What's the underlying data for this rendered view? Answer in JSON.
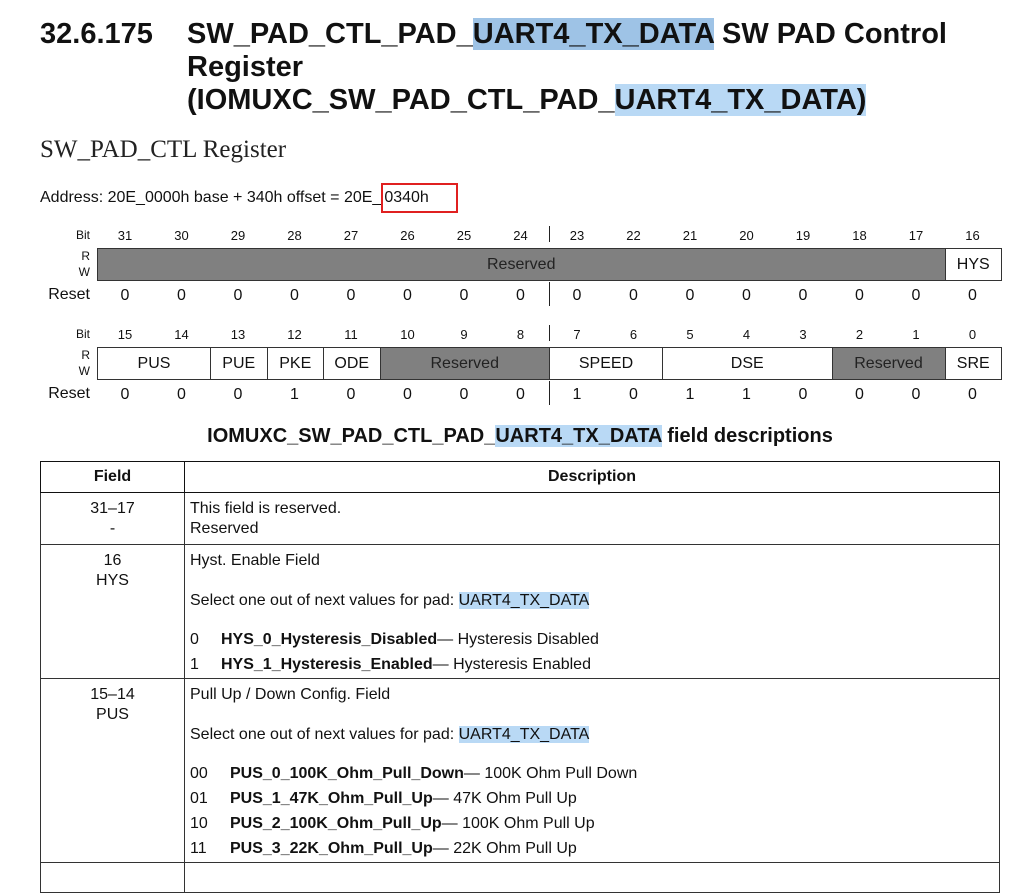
{
  "section": {
    "number": "32.6.175",
    "title_line1_pre": "SW_PAD_CTL_PAD_",
    "title_line1_hl": "UART4_TX_DATA",
    "title_line1_post": " SW PAD Control",
    "title_line2": "Register",
    "title_line3_pre": "(IOMUXC_SW_PAD_CTL_PAD_",
    "title_line3_hl": "UART4_TX_DATA)"
  },
  "subtitle": "SW_PAD_CTL Register",
  "address": {
    "prefix": "Address: 20E_0000h base + 340h offset = 20E_",
    "boxed": "0340h"
  },
  "register": {
    "bit_label": "Bit",
    "r_label": "R",
    "w_label": "W",
    "reset_label": "Reset",
    "upper": {
      "bits": [
        "31",
        "30",
        "29",
        "28",
        "27",
        "26",
        "25",
        "24",
        "23",
        "22",
        "21",
        "20",
        "19",
        "18",
        "17",
        "16"
      ],
      "fields": [
        {
          "name": "Reserved",
          "reserved": true
        },
        {
          "name": "HYS",
          "reserved": false
        }
      ],
      "reset": [
        "0",
        "0",
        "0",
        "0",
        "0",
        "0",
        "0",
        "0",
        "0",
        "0",
        "0",
        "0",
        "0",
        "0",
        "0",
        "0"
      ]
    },
    "lower": {
      "bits": [
        "15",
        "14",
        "13",
        "12",
        "11",
        "10",
        "9",
        "8",
        "7",
        "6",
        "5",
        "4",
        "3",
        "2",
        "1",
        "0"
      ],
      "fields": [
        {
          "name": "PUS",
          "reserved": false
        },
        {
          "name": "PUE",
          "reserved": false
        },
        {
          "name": "PKE",
          "reserved": false
        },
        {
          "name": "ODE",
          "reserved": false
        },
        {
          "name": "Reserved",
          "reserved": true
        },
        {
          "name": "SPEED",
          "reserved": false
        },
        {
          "name": "DSE",
          "reserved": false
        },
        {
          "name": "Reserved",
          "reserved": true
        },
        {
          "name": "SRE",
          "reserved": false
        }
      ],
      "reset": [
        "0",
        "0",
        "0",
        "1",
        "0",
        "0",
        "0",
        "0",
        "1",
        "0",
        "1",
        "1",
        "0",
        "0",
        "0",
        "0"
      ]
    }
  },
  "table": {
    "title_pre": "IOMUXC_SW_PAD_CTL_PAD_",
    "title_hl": "UART4_TX_DATA",
    "title_post": " field descriptions",
    "col_field": "Field",
    "col_desc": "Description",
    "rows": [
      {
        "bits": "31–17",
        "name": "-",
        "line1": "This field is reserved.",
        "line2": "Reserved"
      },
      {
        "bits": "16",
        "name": "HYS",
        "line1": "Hyst. Enable Field",
        "select_pre": "Select one out of next values for pad: ",
        "select_hl": "UART4_TX_DATA",
        "values": [
          {
            "code": "0",
            "name": "HYS_0_Hysteresis_Disabled",
            "desc": " — Hysteresis Disabled"
          },
          {
            "code": "1",
            "name": "HYS_1_Hysteresis_Enabled",
            "desc": " — Hysteresis Enabled"
          }
        ]
      },
      {
        "bits": "15–14",
        "name": "PUS",
        "line1": "Pull Up / Down Config. Field",
        "select_pre": "Select one out of next values for pad: ",
        "select_hl": "UART4_TX_DATA",
        "values": [
          {
            "code": "00",
            "name": "PUS_0_100K_Ohm_Pull_Down",
            "desc": " — 100K Ohm Pull Down"
          },
          {
            "code": "01",
            "name": "PUS_1_47K_Ohm_Pull_Up",
            "desc": " — 47K Ohm Pull Up"
          },
          {
            "code": "10",
            "name": "PUS_2_100K_Ohm_Pull_Up",
            "desc": " — 100K Ohm Pull Up"
          },
          {
            "code": "11",
            "name": "PUS_3_22K_Ohm_Pull_Up",
            "desc": " — 22K Ohm Pull Up"
          }
        ]
      }
    ]
  }
}
